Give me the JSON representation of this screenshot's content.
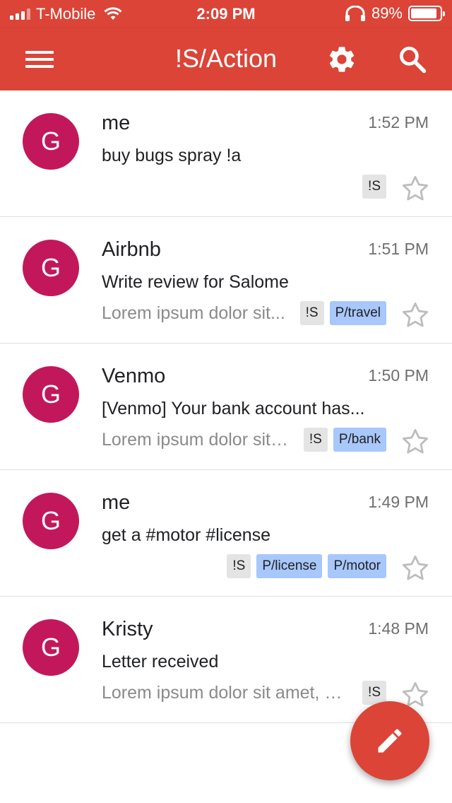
{
  "status_bar": {
    "carrier": "T-Mobile",
    "time": "2:09 PM",
    "battery": "89%",
    "battery_level": 0.89
  },
  "app_bar": {
    "title": "!S/Action",
    "icons": [
      "menu-icon",
      "settings-gear-icon",
      "search-icon"
    ]
  },
  "colors": {
    "brand_red": "#db4437",
    "avatar": "#c2185b",
    "chip_gray": "#e4e4e4",
    "chip_blue": "#a8c7fa"
  },
  "messages": [
    {
      "avatar_letter": "G",
      "sender": "me",
      "time": "1:52 PM",
      "subject": "buy bugs spray !a",
      "snippet": "",
      "labels": [
        "!S"
      ]
    },
    {
      "avatar_letter": "G",
      "sender": "Airbnb",
      "time": "1:51 PM",
      "subject": "Write review for Salome",
      "snippet": "Lorem ipsum dolor sit...",
      "labels": [
        "!S",
        "P/travel"
      ]
    },
    {
      "avatar_letter": "G",
      "sender": "Venmo",
      "time": "1:50 PM",
      "subject": "[Venmo] Your bank account has...",
      "snippet": "Lorem ipsum dolor sit a...",
      "labels": [
        "!S",
        "P/bank"
      ]
    },
    {
      "avatar_letter": "G",
      "sender": "me",
      "time": "1:49 PM",
      "subject": "get a #motor #license",
      "snippet": "",
      "labels": [
        "!S",
        "P/license",
        "P/motor"
      ]
    },
    {
      "avatar_letter": "G",
      "sender": "Kristy",
      "time": "1:48 PM",
      "subject": "Letter received",
      "snippet": "Lorem ipsum dolor sit amet, co...",
      "labels": [
        "!S"
      ]
    }
  ],
  "fab": {
    "icon": "pencil-compose-icon"
  }
}
